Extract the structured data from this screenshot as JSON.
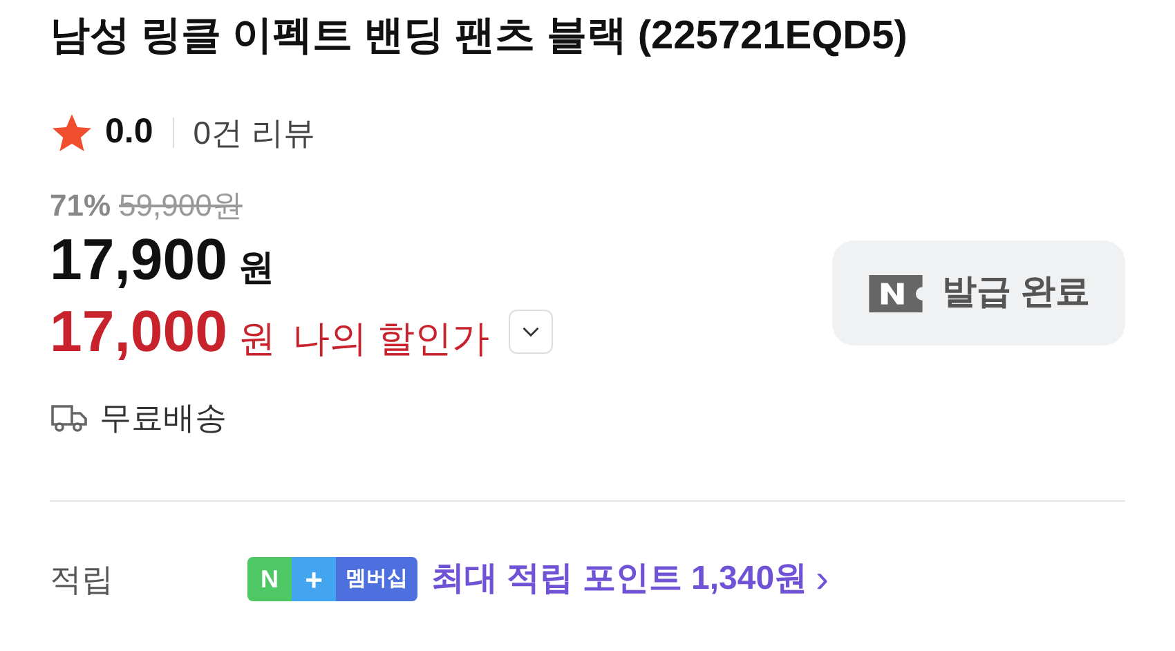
{
  "title": "남성 링클 이펙트 밴딩 팬츠 블랙 (225721EQD5)",
  "rating": {
    "score": "0.0",
    "reviews": "0건 리뷰"
  },
  "price": {
    "discount": "71%",
    "original": "59,900원",
    "sale": "17,900",
    "sale_unit": "원",
    "my_price": "17,000",
    "my_unit": "원",
    "my_label": "나의 할인가",
    "expanded": false
  },
  "coupon_button": {
    "label": "발급 완료"
  },
  "shipping": "무료배송",
  "points": {
    "label": "적립",
    "badge": [
      "N",
      "+",
      "멤버십"
    ],
    "text": "최대 적립 포인트 1,340원",
    "arrow": "›"
  }
}
